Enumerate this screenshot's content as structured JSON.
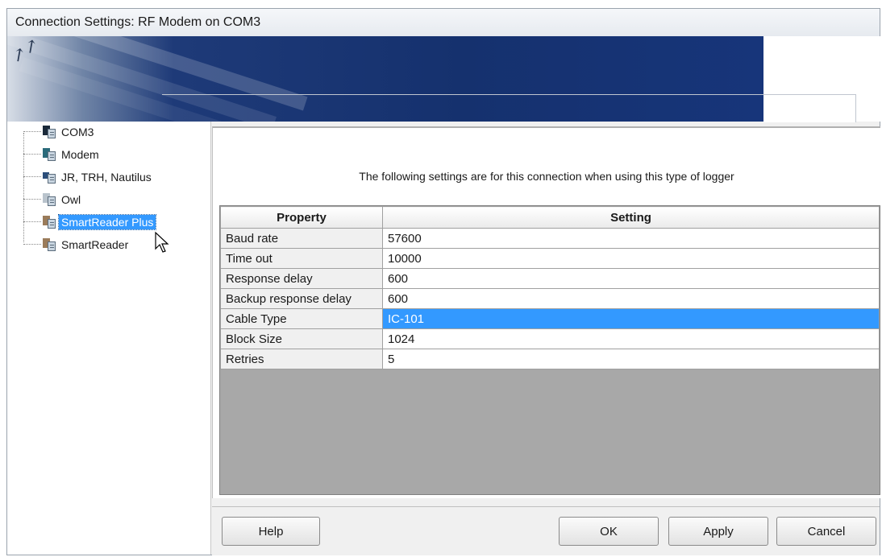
{
  "window": {
    "title": "Connection Settings: RF Modem on COM3"
  },
  "tree": {
    "items": [
      {
        "label": "COM3",
        "icon": "com-port-icon"
      },
      {
        "label": "Modem",
        "icon": "modem-icon"
      },
      {
        "label": "JR, TRH, Nautilus",
        "icon": "logger-icon"
      },
      {
        "label": "Owl",
        "icon": "logger-icon"
      },
      {
        "label": "SmartReader Plus",
        "icon": "logger-icon",
        "selected": true
      },
      {
        "label": "SmartReader",
        "icon": "logger-icon"
      }
    ]
  },
  "panel": {
    "info_text": "The following settings are for this connection when using this type of logger"
  },
  "grid": {
    "headers": {
      "property": "Property",
      "setting": "Setting"
    },
    "rows": [
      {
        "property": "Baud rate",
        "setting": "57600"
      },
      {
        "property": "Time out",
        "setting": "10000"
      },
      {
        "property": "Response delay",
        "setting": "600"
      },
      {
        "property": "Backup response delay",
        "setting": "600"
      },
      {
        "property": "Cable Type",
        "setting": "IC-101",
        "selected": true
      },
      {
        "property": "Block Size",
        "setting": "1024"
      },
      {
        "property": "Retries",
        "setting": "5"
      }
    ]
  },
  "buttons": {
    "help": "Help",
    "ok": "OK",
    "apply": "Apply",
    "cancel": "Cancel"
  },
  "colors": {
    "selection": "#3399ff",
    "banner": "#15316e"
  }
}
